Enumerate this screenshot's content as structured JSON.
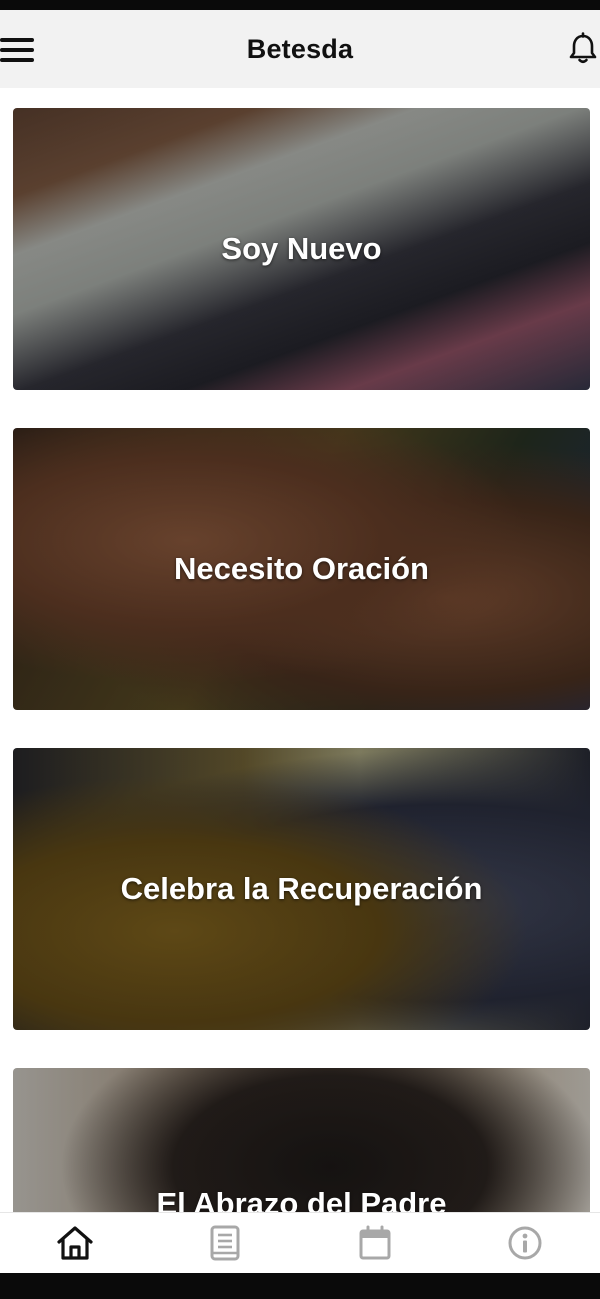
{
  "app": {
    "title": "Betesda"
  },
  "header": {
    "menu_icon": "hamburger-menu-icon",
    "notifications_icon": "bell-icon"
  },
  "cards": [
    {
      "label": "Soy Nuevo"
    },
    {
      "label": "Necesito Oración"
    },
    {
      "label": "Celebra la Recuperación"
    },
    {
      "label": "El Abrazo del Padre"
    }
  ],
  "bottom_nav": {
    "items": [
      {
        "icon": "home-icon",
        "active": true
      },
      {
        "icon": "book-icon",
        "active": false
      },
      {
        "icon": "calendar-icon",
        "active": false
      },
      {
        "icon": "info-icon",
        "active": false
      }
    ]
  },
  "colors": {
    "header_bg": "#f2f2f2",
    "nav_active": "#111111",
    "nav_inactive": "#a8a8a8",
    "card_text": "#ffffff"
  }
}
